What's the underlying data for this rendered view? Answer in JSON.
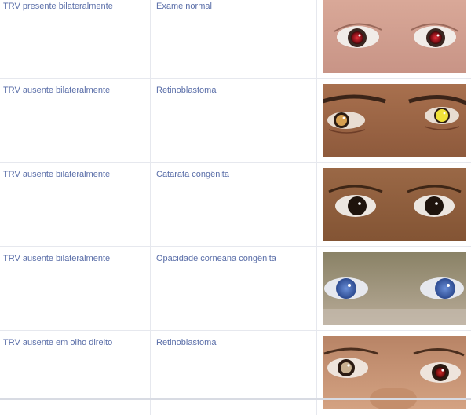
{
  "rows": [
    {
      "exam": "TRV presente bilateralmente",
      "diagnosis": "Exame normal",
      "photo": "eyes-normal-red-reflex"
    },
    {
      "exam": "TRV ausente bilateralmente",
      "diagnosis": "Retinoblastoma",
      "photo": "eyes-bilateral-leukocoria"
    },
    {
      "exam": "TRV ausente bilateralmente",
      "diagnosis": "Catarata congênita",
      "photo": "eyes-congenital-cataract"
    },
    {
      "exam": "TRV ausente bilateralmente",
      "diagnosis": "Opacidade corneana congênita",
      "photo": "eyes-corneal-opacity"
    },
    {
      "exam": "TRV ausente em olho direito",
      "diagnosis": "Retinoblastoma",
      "photo": "eyes-unilateral-leukocoria"
    }
  ]
}
